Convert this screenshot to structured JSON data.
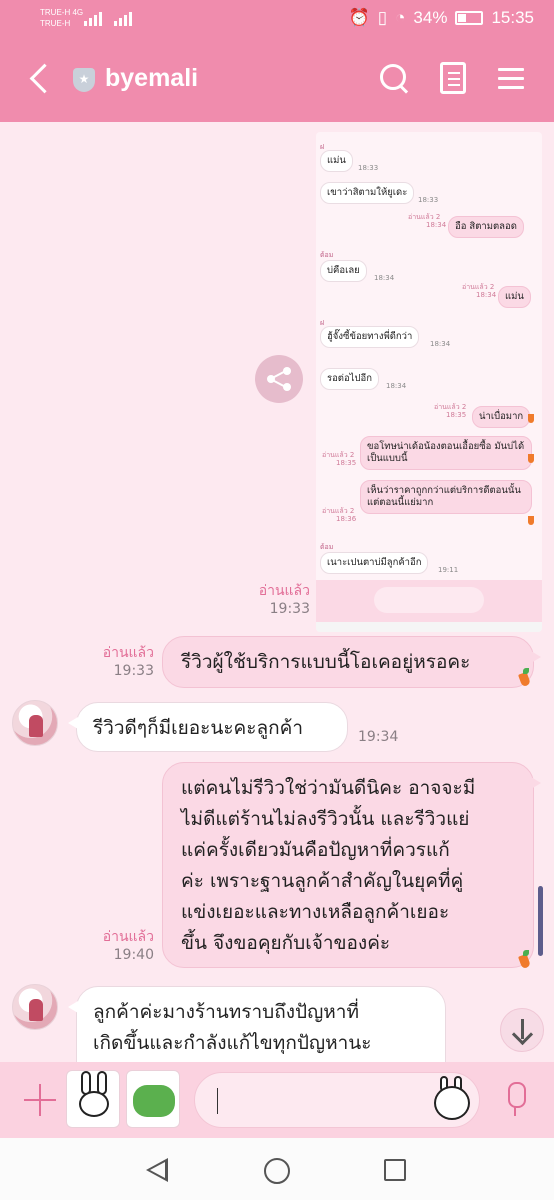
{
  "status_bar": {
    "carrier_1": "TRUE-H",
    "carrier_2": "TRUE-H",
    "network": "4G",
    "battery": "34%",
    "time": "15:35"
  },
  "header": {
    "title": "byemali",
    "icons": [
      "back-icon",
      "shield-icon",
      "search-icon",
      "note-icon",
      "menu-icon"
    ]
  },
  "embedded_screenshot": {
    "messages": [
      {
        "from": "them",
        "name": "ฝ",
        "text": "แม่น",
        "time": "18:33"
      },
      {
        "from": "them",
        "text": "เขาว่าสิตามให้ยูเดะ",
        "time": "18:33"
      },
      {
        "from": "me",
        "read": "อ่านแล้ว 2",
        "text": "อือ สิตามตลอด",
        "time": "18:34"
      },
      {
        "from": "them",
        "name": "ต้อม",
        "text": "บ่คือเลย",
        "time": "18:34"
      },
      {
        "from": "me",
        "read": "อ่านแล้ว 2",
        "text": "แม่น",
        "time": "18:34"
      },
      {
        "from": "them",
        "name": "ฝ",
        "text": "ฮู้จั๊งซี้ข้อยทางพี่ดีกว่า",
        "time": "18:34"
      },
      {
        "from": "them",
        "text": "รอต่อไปอีก",
        "time": "18:34"
      },
      {
        "from": "me",
        "read": "อ่านแล้ว 2",
        "text": "น่าเบื่อมาก",
        "time": "18:35"
      },
      {
        "from": "me",
        "read": "อ่านแล้ว 2",
        "text": "ขอโทษน่าเด้อน้องตอนเอื้อยซื้อ มันบ่ได้เป็นแบบนี้",
        "time": "18:35"
      },
      {
        "from": "me",
        "read": "อ่านแล้ว 2",
        "text": "เห็นว่าราคาถูกกว่าแต่บริการดีตอนนั้น แต่ตอนนี้แย่มาก",
        "time": "18:36"
      },
      {
        "from": "them",
        "name": "ต้อม",
        "text": "เนาะเปนตาบ่มีลูกค้าอีก",
        "time": "19:11"
      }
    ]
  },
  "messages": [
    {
      "from": "me",
      "type": "image",
      "read": "อ่านแล้ว",
      "time": "19:33"
    },
    {
      "from": "me",
      "read": "อ่านแล้ว",
      "time": "19:33",
      "text": "รีวิวผู้ใช้บริการแบบนี้โอเคอยู่หรอคะ"
    },
    {
      "from": "them",
      "time": "19:34",
      "text": "รีวิวดีๆก็มีเยอะนะคะลูกค้า"
    },
    {
      "from": "me",
      "read": "อ่านแล้ว",
      "time": "19:40",
      "lines": [
        "แต่คนไม่รีวิวใช่ว่ามันดีนิคะ  อาจจะมี",
        "ไม่ดีแต่ร้านไม่ลงรีวิวนั้น  และรีวิวแย่",
        "แค่ครั้งเดียวมันคือปัญหาที่ควรแก้",
        "ค่ะ  เพราะฐานลูกค้าสำคัญในยุคที่คู่",
        "แข่งเยอะและทางเหลือลูกค้าเยอะ",
        "ขึ้น   จึงขอคุยกับเจ้าของค่ะ"
      ]
    },
    {
      "from": "them",
      "lines": [
        "ลูกค้าค่ะมางร้านทราบถึงปัญหาที่",
        "เกิดขึ้นและกำลังแก้ไขทุกปัญหานะ"
      ]
    }
  ],
  "composer": {
    "value": "",
    "icons": [
      "plus-icon",
      "bunny-sticker",
      "frog-sticker",
      "emoji-icon",
      "mic-icon"
    ]
  },
  "colors": {
    "header": "#f08cad",
    "chat_bg": "#fde9f0",
    "my_bubble": "#fbd9e5",
    "read_receipt": "#e26e97"
  }
}
